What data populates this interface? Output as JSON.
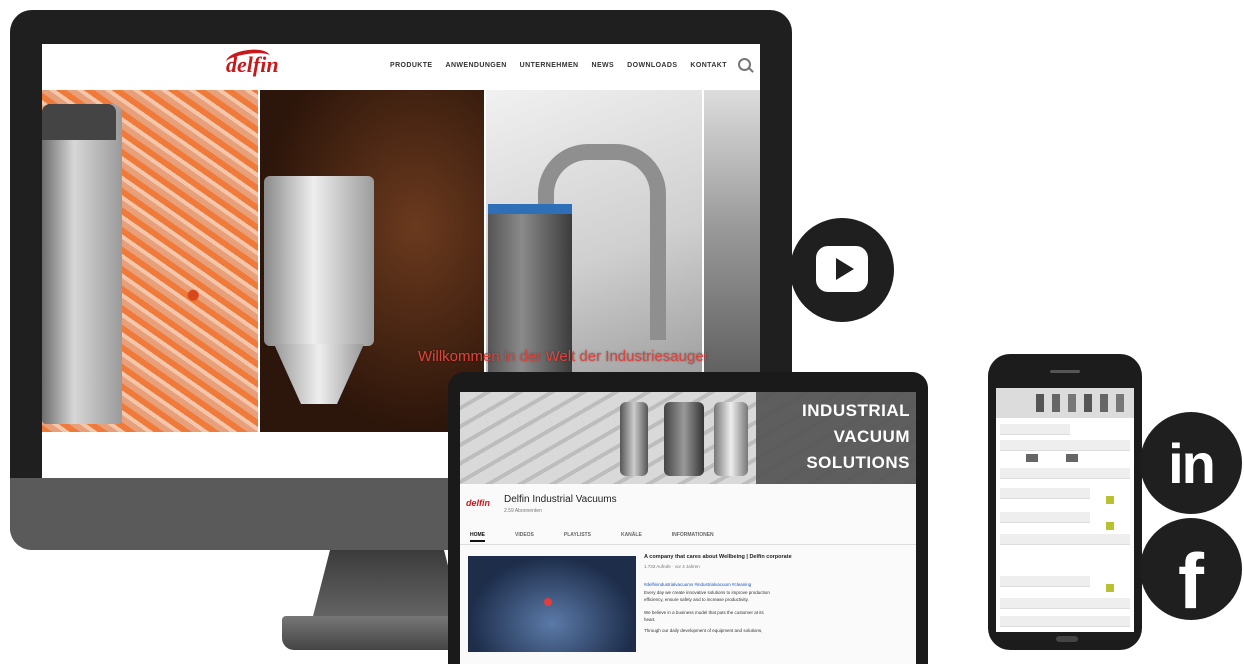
{
  "monitor": {
    "site": {
      "logo": "delfin",
      "nav": [
        "PRODUKTE",
        "ANWENDUNGEN",
        "UNTERNEHMEN",
        "NEWS",
        "DOWNLOADS",
        "KONTAKT"
      ],
      "hero_text": "Willkommen in der Welt der Industriesauger"
    }
  },
  "tablet": {
    "banner_lines": [
      "INDUSTRIAL",
      "VACUUM",
      "SOLUTIONS"
    ],
    "channel_logo": "delfin",
    "channel_name": "Delfin Industrial Vacuums",
    "channel_sub": "2.59 Abonnenten",
    "tabs": [
      "HOME",
      "VIDEOS",
      "PLAYLISTS",
      "KANÄLE",
      "INFORMATIONEN"
    ],
    "video": {
      "title": "A company that cares about Wellbeing | Delfin corporate",
      "meta": "1.733 Aufrufe · vor 4 Jahren",
      "link": "#delfinindustrialvacuums #industrialvacuum #cleaning",
      "lines": [
        "Every day we create innovative solutions to improve production",
        "efficiency, ensure safety and to increase productivity.",
        "We believe in a business model that puts the customer at its",
        "heart.",
        "Through our daily development of equipment and solutions,"
      ]
    }
  },
  "social": {
    "linkedin": "in",
    "facebook": "f",
    "youtube_color": "#1f1f1f"
  },
  "colors": {
    "brand_red": "#c8181b",
    "device_dark": "#1f1f1f"
  }
}
